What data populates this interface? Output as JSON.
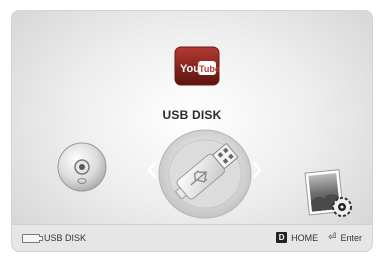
{
  "youtube": {
    "label_you": "You",
    "label_tube": "Tube"
  },
  "menu": {
    "selected_title": "USB DISK",
    "items": [
      "YouTube",
      "Disc",
      "USB DISK",
      "Photos"
    ]
  },
  "status_bar": {
    "source_label": "USB DISK",
    "home_key": "D",
    "home_label": "HOME",
    "enter_glyph": "⏎",
    "enter_label": "Enter"
  },
  "icons": [
    "youtube-icon",
    "disc-icon",
    "usb-icon",
    "photo-settings-icon",
    "chevron-left-icon",
    "chevron-right-icon",
    "usb-small-icon"
  ],
  "colors": {
    "background": "#e9e9e9",
    "status_bar": "#e6e6e6",
    "youtube_red": "#8b0000"
  }
}
